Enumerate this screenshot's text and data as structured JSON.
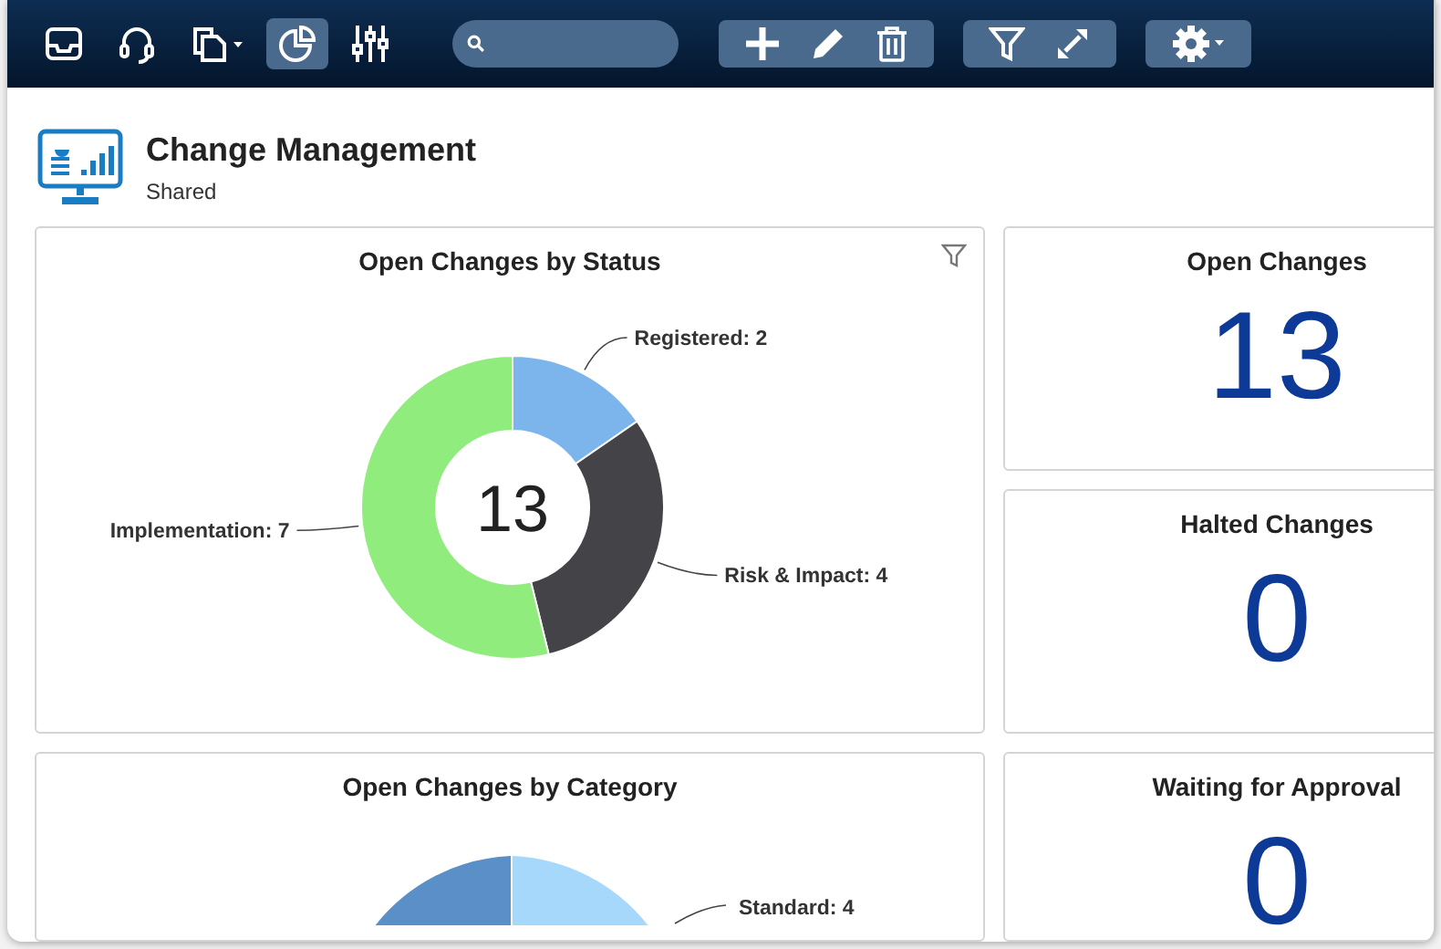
{
  "toolbar": {
    "nav": [
      {
        "kind": "inbox",
        "selected": false
      },
      {
        "kind": "headset",
        "selected": false
      },
      {
        "kind": "copy",
        "selected": false
      },
      {
        "kind": "pie",
        "selected": true
      },
      {
        "kind": "sliders",
        "selected": false
      }
    ],
    "groups": [
      [
        {
          "kind": "plus"
        },
        {
          "kind": "pencil"
        },
        {
          "kind": "trash"
        }
      ],
      [
        {
          "kind": "filter"
        },
        {
          "kind": "expand"
        }
      ],
      [
        {
          "kind": "gear"
        }
      ]
    ]
  },
  "header": {
    "title": "Change Management",
    "subtitle": "Shared"
  },
  "status_chart": {
    "title": "Open Changes by Status",
    "center": "13",
    "chart_data": {
      "type": "donut",
      "categories": [
        "Registered: 2",
        "Risk & Impact: 4",
        "Implementation: 7"
      ],
      "values": [
        2,
        4,
        7
      ],
      "colors": [
        "#7cb5ec",
        "#434348",
        "#90ed7d"
      ]
    }
  },
  "kpis": [
    {
      "title": "Open Changes",
      "value": "13"
    },
    {
      "title": "Halted Changes",
      "value": "0"
    }
  ],
  "category_chart": {
    "title": "Open Changes by Category",
    "label": "Standard: 4"
  },
  "kpi_bottom": {
    "title": "Waiting for Approval",
    "value": "0"
  }
}
